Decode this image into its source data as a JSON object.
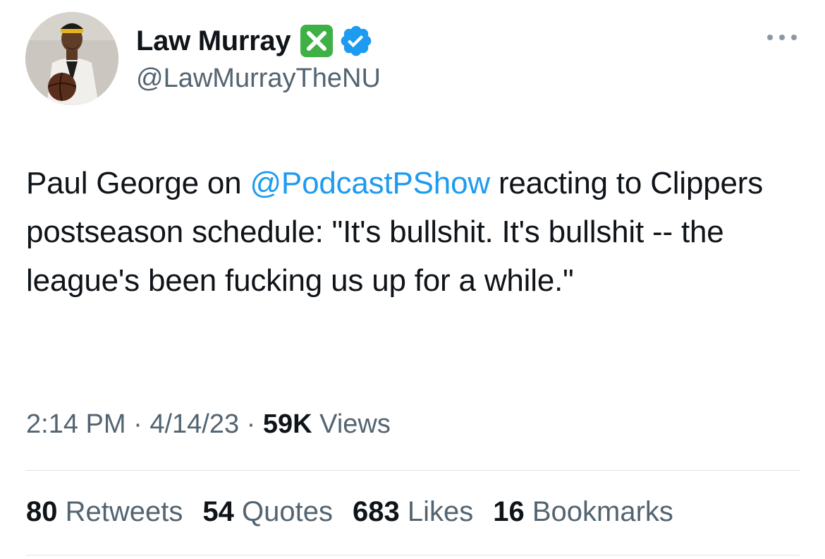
{
  "author": {
    "display_name": "Law Murray",
    "handle": "@LawMurrayTheNU",
    "name_emoji": "cross-mark-button-icon",
    "verified_badge": "verified-badge-icon",
    "avatar": "profile-photo"
  },
  "menu_icon": "more-options-icon",
  "tweet": {
    "text_before_mention": "Paul George on ",
    "mention": "@PodcastPShow",
    "text_after_mention": " reacting to Clippers postseason schedule: \"It's bullshit. It's bullshit -- the league's been fucking us up for a while.\""
  },
  "meta": {
    "time": "2:14 PM",
    "sep1": " · ",
    "date": "4/14/23",
    "sep2": " · ",
    "views_count": "59K",
    "views_label": " Views"
  },
  "stats": [
    {
      "count": "80",
      "label": "Retweets"
    },
    {
      "count": "54",
      "label": "Quotes"
    },
    {
      "count": "683",
      "label": "Likes"
    },
    {
      "count": "16",
      "label": "Bookmarks"
    }
  ],
  "colors": {
    "link": "#1d9bf0",
    "secondary_text": "#536471",
    "primary_text": "#0f1419",
    "x_emoji_green": "#3fb045",
    "divider": "#dfe3e6"
  }
}
